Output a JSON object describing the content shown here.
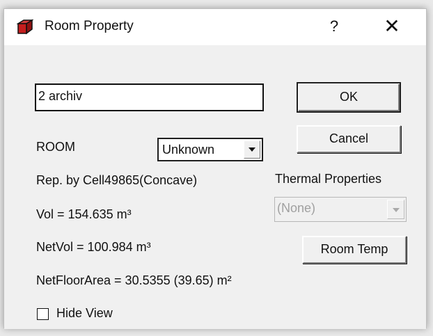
{
  "window": {
    "title": "Room Property",
    "help_label": "?",
    "close_label": "✕"
  },
  "form": {
    "name_value": "2 archiv",
    "room_label": "ROOM",
    "room_type_selected": "Unknown",
    "rep_text": "Rep. by Cell49865(Concave)",
    "vol_text": "Vol = 154.635 m³",
    "netvol_text": "NetVol = 100.984 m³",
    "netfloor_text": "NetFloorArea = 30.5355 (39.65) m²",
    "thermal_label": "Thermal Properties",
    "thermal_selected": "(None)",
    "hide_view_label": "Hide View",
    "hide_view_checked": false
  },
  "buttons": {
    "ok_label": "OK",
    "cancel_label": "Cancel",
    "room_temp_label": "Room Temp"
  },
  "icons": {
    "title_icon": "room-cube-icon",
    "room_dropdown_icon": "chevron-down-icon",
    "thermal_dropdown_icon": "chevron-down-icon"
  },
  "colors": {
    "window_bg": "#f0f0f0",
    "titlebar_bg": "#ffffff",
    "disabled_text": "#a0a0a0",
    "icon_red": "#c41e1e"
  }
}
